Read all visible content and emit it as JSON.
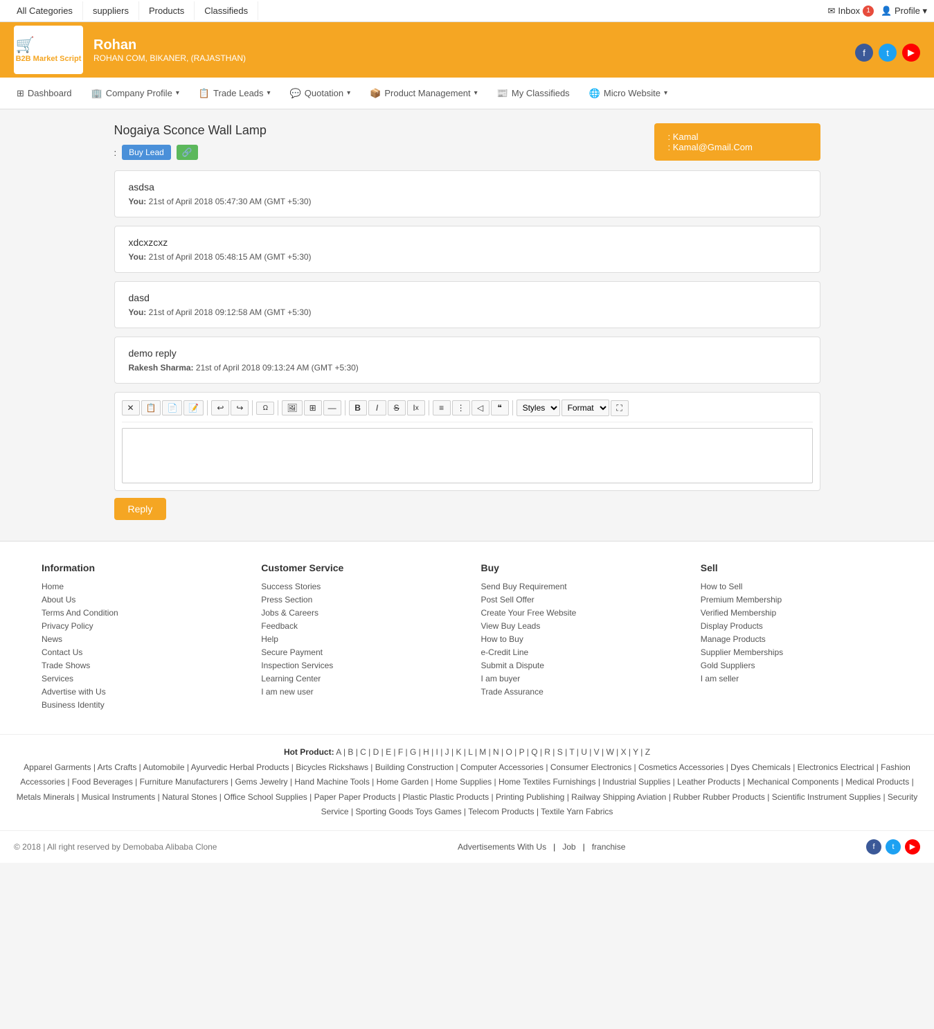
{
  "topNav": {
    "items": [
      "All Categories",
      "suppliers",
      "Products",
      "Classifieds"
    ],
    "inbox_label": "Inbox",
    "inbox_count": "1",
    "profile_label": "Profile"
  },
  "header": {
    "logo_icon": "🛒",
    "logo_line1": "B2B Market Script",
    "user_name": "Rohan",
    "user_sub": "ROHAN COM, BIKANER, (RAJASTHAN)",
    "social": [
      "f",
      "t",
      "▶"
    ]
  },
  "secNav": {
    "items": [
      "Dashboard",
      "Company Profile",
      "Trade Leads",
      "Quotation",
      "Product Management",
      "My Classifieds",
      "Micro Website"
    ]
  },
  "page": {
    "title": "Nogaiya Sconce Wall Lamp",
    "buyLeadLabel": "Buy Lead",
    "linkLabel": "🔗",
    "contact": {
      "name_label": ": Kamal",
      "email_label": ": Kamal@Gmail.Com"
    }
  },
  "messages": [
    {
      "text": "asdsa",
      "sender": "You:",
      "timestamp": "21st of April 2018 05:47:30 AM (GMT +5:30)"
    },
    {
      "text": "xdcxzcxz",
      "sender": "You:",
      "timestamp": "21st of April 2018 05:48:15 AM (GMT +5:30)"
    },
    {
      "text": "dasd",
      "sender": "You:",
      "timestamp": "21st of April 2018 09:12:58 AM (GMT +5:30)"
    },
    {
      "text": "demo reply",
      "sender": "Rakesh Sharma:",
      "timestamp": "21st of April 2018 09:13:24 AM (GMT +5:30)"
    }
  ],
  "editor": {
    "stylesLabel": "Styles",
    "formatLabel": "Format",
    "replyLabel": "Reply"
  },
  "footer": {
    "information": {
      "heading": "Information",
      "links": [
        "Home",
        "About Us",
        "Terms And Condition",
        "Privacy Policy",
        "News",
        "Contact Us",
        "Trade Shows",
        "Services",
        "Advertise with Us",
        "Business Identity"
      ]
    },
    "customerService": {
      "heading": "Customer Service",
      "links": [
        "Success Stories",
        "Press Section",
        "Jobs & Careers",
        "Feedback",
        "Help",
        "Secure Payment",
        "Inspection Services",
        "Learning Center",
        "I am new user"
      ]
    },
    "buy": {
      "heading": "Buy",
      "links": [
        "Send Buy Requirement",
        "Post Sell Offer",
        "Create Your Free Website",
        "View Buy Leads",
        "How to Buy",
        "e-Credit Line",
        "Submit a Dispute",
        "I am buyer",
        "Trade Assurance"
      ]
    },
    "sell": {
      "heading": "Sell",
      "links": [
        "How to Sell",
        "Premium Membership",
        "Verified Membership",
        "Display Products",
        "Manage Products",
        "Supplier Memberships",
        "Gold Suppliers",
        "I am seller"
      ]
    }
  },
  "hotProducts": {
    "label": "Hot Product:",
    "letters": [
      "A",
      "B",
      "C",
      "D",
      "E",
      "F",
      "G",
      "H",
      "I",
      "J",
      "K",
      "L",
      "M",
      "N",
      "O",
      "P",
      "Q",
      "R",
      "S",
      "T",
      "U",
      "V",
      "W",
      "X",
      "Y",
      "Z"
    ],
    "products": [
      "Apparel Garments",
      "Arts Crafts",
      "Automobile",
      "Ayurvedic Herbal Products",
      "Bicycles Rickshaws",
      "Building Construction",
      "Computer Accessories",
      "Consumer Electronics",
      "Cosmetics Accessories",
      "Dyes Chemicals",
      "Electronics Electrical",
      "Fashion Accessories",
      "Food Beverages",
      "Furniture Manufacturers",
      "Gems Jewelry",
      "Hand Machine Tools",
      "Home Garden",
      "Home Supplies",
      "Home Textiles Furnishings",
      "Industrial Supplies",
      "Leather Products",
      "Mechanical Components",
      "Medical Products",
      "Metals Minerals",
      "Musical Instruments",
      "Natural Stones",
      "Office School Supplies",
      "Paper Paper Products",
      "Plastic Plastic Products",
      "Printing Publishing",
      "Railway Shipping Aviation",
      "Rubber Rubber Products",
      "Scientific Instrument Supplies",
      "Security Service",
      "Sporting Goods Toys Games",
      "Telecom Products",
      "Textile Yarn Fabrics"
    ]
  },
  "bottomFooter": {
    "links": [
      "Advertisements With Us",
      "Job",
      "franchise"
    ],
    "copyright": "© 2018 | All right reserved by Demobaba Alibaba Clone"
  }
}
